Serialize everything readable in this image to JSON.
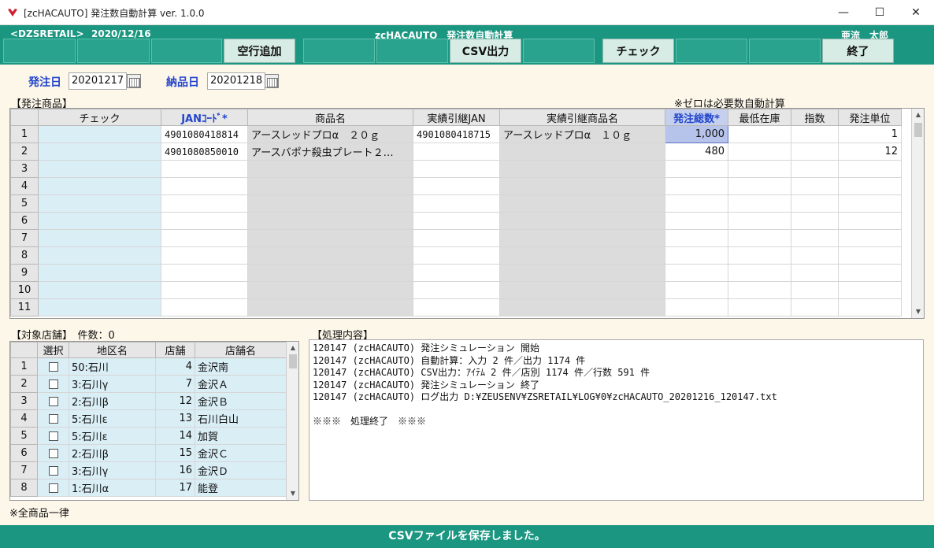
{
  "window": {
    "title": "[zcHACAUTO] 発注数自動計算 ver. 1.0.0",
    "minimize": "—",
    "maximize": "☐",
    "close": "✕"
  },
  "header": {
    "store_tag": "<DZSRETAIL>",
    "date": "2020/12/16",
    "app_name": "zcHACAUTO　発注数自動計算",
    "user": "亜流　太郎"
  },
  "function_keys": {
    "add_row": "空行追加",
    "csv_output": "CSV出力",
    "check": "チェック",
    "exit": "終了"
  },
  "dates": {
    "order_label": "発注日",
    "order_value": "20201217",
    "delivery_label": "納品日",
    "delivery_value": "20201218"
  },
  "products": {
    "section_label": "【発注商品】",
    "note": "※ゼロは必要数自動計算",
    "columns": [
      "チェック",
      "JANｺｰﾄﾞ*",
      "商品名",
      "実績引継JAN",
      "実績引継商品名",
      "発注総数*",
      "最低在庫",
      "指数",
      "発注単位"
    ],
    "rows": [
      [
        "1",
        "",
        "4901080418814",
        "アースレッドプロα　２０ｇ",
        "4901080418715",
        "アースレッドプロα　１０ｇ",
        "1,000",
        "",
        "",
        "1"
      ],
      [
        "2",
        "",
        "4901080850010",
        "アースバポナ殺虫プレート２…",
        "",
        "",
        "480",
        "",
        "",
        "12"
      ],
      [
        "3",
        "",
        "",
        "",
        "",
        "",
        "",
        "",
        "",
        ""
      ],
      [
        "4",
        "",
        "",
        "",
        "",
        "",
        "",
        "",
        "",
        ""
      ],
      [
        "5",
        "",
        "",
        "",
        "",
        "",
        "",
        "",
        "",
        ""
      ],
      [
        "6",
        "",
        "",
        "",
        "",
        "",
        "",
        "",
        "",
        ""
      ],
      [
        "7",
        "",
        "",
        "",
        "",
        "",
        "",
        "",
        "",
        ""
      ],
      [
        "8",
        "",
        "",
        "",
        "",
        "",
        "",
        "",
        "",
        ""
      ],
      [
        "9",
        "",
        "",
        "",
        "",
        "",
        "",
        "",
        "",
        ""
      ],
      [
        "10",
        "",
        "",
        "",
        "",
        "",
        "",
        "",
        "",
        ""
      ],
      [
        "11",
        "",
        "",
        "",
        "",
        "",
        "",
        "",
        "",
        ""
      ]
    ]
  },
  "stores": {
    "section_label": "【対象店舗】　件数：0",
    "columns": [
      "選択",
      "地区名",
      "店舗",
      "店舗名"
    ],
    "rows": [
      [
        "1",
        "50:石川",
        "4",
        "金沢南"
      ],
      [
        "2",
        "3:石川γ",
        "7",
        "金沢Ａ"
      ],
      [
        "3",
        "2:石川β",
        "12",
        "金沢Ｂ"
      ],
      [
        "4",
        "5:石川ε",
        "13",
        "石川白山"
      ],
      [
        "5",
        "5:石川ε",
        "14",
        "加賀"
      ],
      [
        "6",
        "2:石川β",
        "15",
        "金沢Ｃ"
      ],
      [
        "7",
        "3:石川γ",
        "16",
        "金沢Ｄ"
      ],
      [
        "8",
        "1:石川α",
        "17",
        "能登"
      ]
    ],
    "footer_note": "※全商品一律"
  },
  "log": {
    "section_label": "【処理内容】",
    "lines": [
      "120147 (zcHACAUTO) 発注シミュレーション 開始",
      "120147 (zcHACAUTO) 自動計算：入力 2 件／出力 1174 件",
      "120147 (zcHACAUTO) CSV出力：ｱｲﾃﾑ 2 件／店別 1174 件／行数 591 件",
      "120147 (zcHACAUTO) 発注シミュレーション 終了",
      "120147 (zcHACAUTO) ログ出力 D:¥ZEUSENV¥ZSRETAIL¥LOG¥0¥zcHACAUTO_20201216_120147.txt",
      "",
      "※※※　処理終了　※※※"
    ]
  },
  "status": {
    "message": "CSVファイルを保存しました。"
  },
  "colors": {
    "header_bg": "#1b9680",
    "label_blue": "#2244cc",
    "check_col": "#daeef6",
    "gray_col": "#dcdcdc"
  }
}
